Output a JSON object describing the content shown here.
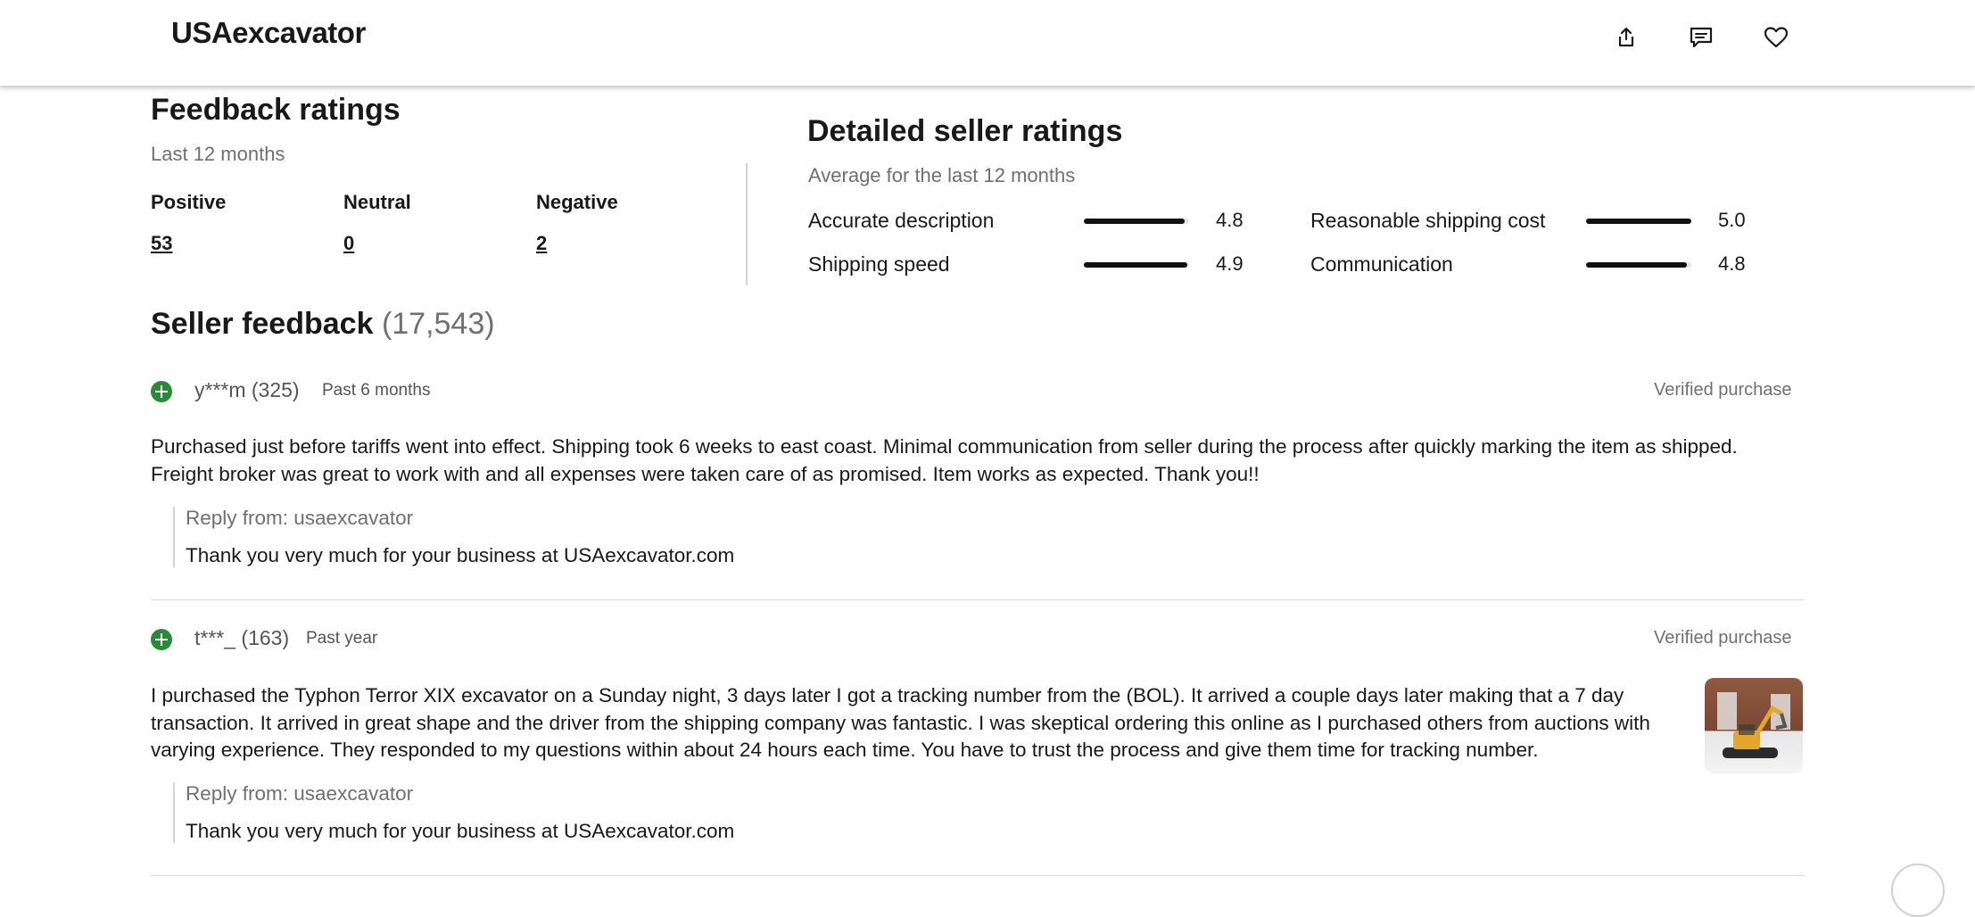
{
  "header": {
    "brand": "USAexcavator"
  },
  "feedback_ratings": {
    "title": "Feedback ratings",
    "period": "Last 12 months",
    "positive_label": "Positive",
    "positive_value": "53",
    "neutral_label": "Neutral",
    "neutral_value": "0",
    "negative_label": "Negative",
    "negative_value": "2"
  },
  "detailed_ratings": {
    "title": "Detailed seller ratings",
    "subtitle": "Average for the last 12 months",
    "items": [
      {
        "label": "Accurate description",
        "value": "4.8",
        "fraction": 0.96
      },
      {
        "label": "Reasonable shipping cost",
        "value": "5.0",
        "fraction": 1.0
      },
      {
        "label": "Shipping speed",
        "value": "4.9",
        "fraction": 0.98
      },
      {
        "label": "Communication",
        "value": "4.8",
        "fraction": 0.96
      }
    ]
  },
  "seller_feedback": {
    "title": "Seller feedback",
    "count": "(17,543)",
    "entries": [
      {
        "user": "y***m (325)",
        "when": "Past 6 months",
        "verified": "Verified purchase",
        "comment_line1": "Purchased just before tariffs went into effect. Shipping took 6 weeks to east coast. Minimal communication from seller during the process after quickly marking the item as shipped.",
        "comment_line2": "Freight broker was great to work with and all expenses were taken care of as promised. Item works as expected. Thank you!!",
        "reply_label": "Reply from: usaexcavator",
        "reply_text": "Thank you very much for your business at USAexcavator.com"
      },
      {
        "user": "t***_ (163)",
        "when": "Past year",
        "verified": "Verified purchase",
        "comment_line1": "I purchased the Typhon Terror XIX excavator on a Sunday night, 3 days later I got a tracking number from the (BOL). It arrived a couple days later making that a 7 day",
        "comment_line2": "transaction. It arrived in great shape and the driver from the shipping company was fantastic. I was skeptical ordering this online as I purchased others from auctions with",
        "comment_line3": "varying experience. They responded to my questions within about 24 hours each time. You have to trust the process and give them time for tracking number.",
        "reply_label": "Reply from: usaexcavator",
        "reply_text": "Thank you very much for your business at USAexcavator.com"
      }
    ]
  },
  "colors": {
    "positive_green": "#2a8a39",
    "bar_fill": "#111111",
    "muted_text": "#707070"
  },
  "icons": [
    "share-icon",
    "message-icon",
    "heart-icon",
    "plus-circle-icon"
  ]
}
